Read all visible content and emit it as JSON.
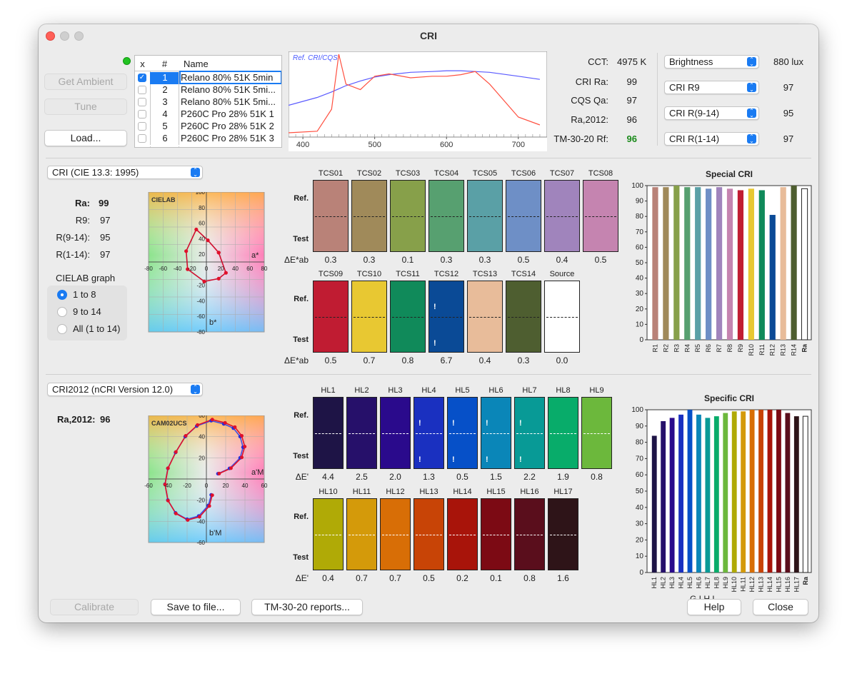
{
  "window": {
    "title": "CRI"
  },
  "left_buttons": {
    "get_ambient": "Get Ambient",
    "tune": "Tune",
    "load": "Load..."
  },
  "list": {
    "headers": {
      "x": "x",
      "num": "#",
      "name": "Name"
    },
    "rows": [
      {
        "num": "1",
        "name": "Relano 80% 51K 5min",
        "checked": true,
        "selected": true
      },
      {
        "num": "2",
        "name": "Relano 80% 51K 5mi...",
        "checked": false
      },
      {
        "num": "3",
        "name": "Relano 80% 51K 5mi...",
        "checked": false
      },
      {
        "num": "4",
        "name": "P260C Pro 28% 51K 1",
        "checked": false
      },
      {
        "num": "5",
        "name": "P260C Pro 28% 51K 2",
        "checked": false
      },
      {
        "num": "6",
        "name": "P260C Pro 28% 51K 3",
        "checked": false
      }
    ]
  },
  "spectrum": {
    "legend": "Ref. CRI/CQS",
    "x_ticks": [
      "400",
      "500",
      "600",
      "700"
    ],
    "ref_color": "#5a5aff",
    "test_color": "#ff5040"
  },
  "metrics": {
    "cct_label": "CCT:",
    "cct_value": "4975 K",
    "cri_ra_label": "CRI Ra:",
    "cri_ra_value": "99",
    "cqs_label": "CQS Qa:",
    "cqs_value": "97",
    "ra2012_label": "Ra,2012:",
    "ra2012_value": "96",
    "tm30_label": "TM-30-20 Rf:",
    "tm30_value": "96",
    "tm30_color": "#1a8a1a"
  },
  "selectors": [
    {
      "label": "Brightness",
      "value": "880 lux"
    },
    {
      "label": "CRI R9",
      "value": "97"
    },
    {
      "label": "CRI R(9-14)",
      "value": "95"
    },
    {
      "label": "CRI R(1-14)",
      "value": "97"
    }
  ],
  "cri_section": {
    "method": "CRI (CIE 13.3: 1995)",
    "ra_label": "Ra:",
    "ra_value": "99",
    "r9_label": "R9:",
    "r9_value": "97",
    "r914_label": "R(9-14):",
    "r914_value": "95",
    "r114_label": "R(1-14):",
    "r114_value": "97",
    "graph_title": "CIELAB graph",
    "radio_options": [
      "1 to 8",
      "9 to 14",
      "All (1 to 14)"
    ],
    "radio_selected": 0,
    "plot_label": "CIELAB",
    "axis_a": "a*",
    "axis_b": "b*",
    "x_ticks": [
      "-80",
      "-60",
      "-40",
      "-20",
      "0",
      "20",
      "40",
      "60",
      "80"
    ],
    "y_ticks": [
      "100",
      "80",
      "60",
      "40",
      "20",
      "0",
      "-20",
      "-40",
      "-60",
      "-80"
    ],
    "tcs_row1": [
      {
        "name": "TCS01",
        "color": "#b98278",
        "de": "0.3"
      },
      {
        "name": "TCS02",
        "color": "#a08a5a",
        "de": "0.3"
      },
      {
        "name": "TCS03",
        "color": "#87a04a",
        "de": "0.1"
      },
      {
        "name": "TCS04",
        "color": "#57a070",
        "de": "0.3"
      },
      {
        "name": "TCS05",
        "color": "#5aa0a6",
        "de": "0.3"
      },
      {
        "name": "TCS06",
        "color": "#6e8fc6",
        "de": "0.5"
      },
      {
        "name": "TCS07",
        "color": "#a084bc",
        "de": "0.4"
      },
      {
        "name": "TCS08",
        "color": "#c584b0",
        "de": "0.5"
      }
    ],
    "tcs_row2": [
      {
        "name": "TCS09",
        "color": "#c01c32",
        "de": "0.5"
      },
      {
        "name": "TCS10",
        "color": "#e8c832",
        "de": "0.7"
      },
      {
        "name": "TCS11",
        "color": "#108a5a",
        "de": "0.8"
      },
      {
        "name": "TCS12",
        "color": "#0a4a96",
        "de": "6.7",
        "warn": true
      },
      {
        "name": "TCS13",
        "color": "#e8bc9a",
        "de": "0.4"
      },
      {
        "name": "TCS14",
        "color": "#4e5e30",
        "de": "0.3"
      },
      {
        "name": "Source",
        "color": "#ffffff",
        "de": "0.0"
      }
    ],
    "ref_label": "Ref.",
    "test_label": "Test",
    "de_label": "ΔE*ab"
  },
  "special_cri": {
    "title": "Special CRI",
    "y_ticks": [
      "100",
      "90",
      "80",
      "70",
      "60",
      "50",
      "40",
      "30",
      "20",
      "10",
      "0"
    ],
    "ylim": [
      0,
      100
    ]
  },
  "cri2012_section": {
    "method": "CRI2012 (nCRI Version 12.0)",
    "ra_label": "Ra,2012:",
    "ra_value": "96",
    "plot_label": "CAM02UCS",
    "axis_a": "a'M",
    "axis_b": "b'M",
    "x_ticks": [
      "-60",
      "-40",
      "-20",
      "0",
      "20",
      "40",
      "60"
    ],
    "y_ticks": [
      "60",
      "40",
      "20",
      "0",
      "-20",
      "-40",
      "-60"
    ],
    "hl_row1": [
      {
        "name": "HL1",
        "color": "#1e1446",
        "de": "4.4"
      },
      {
        "name": "HL2",
        "color": "#26106a",
        "de": "2.5"
      },
      {
        "name": "HL3",
        "color": "#2a0a8c",
        "de": "2.0"
      },
      {
        "name": "HL4",
        "color": "#1a30c0",
        "de": "1.3",
        "warn": true
      },
      {
        "name": "HL5",
        "color": "#0650c8",
        "de": "0.5",
        "warn": true
      },
      {
        "name": "HL6",
        "color": "#0a86b8",
        "de": "1.5",
        "warn": true
      },
      {
        "name": "HL7",
        "color": "#089a96",
        "de": "2.2",
        "warn": true
      },
      {
        "name": "HL8",
        "color": "#08ac6a",
        "de": "1.9"
      },
      {
        "name": "HL9",
        "color": "#6cb83c",
        "de": "0.8"
      }
    ],
    "hl_row2": [
      {
        "name": "HL10",
        "color": "#b0aa06",
        "de": "0.4"
      },
      {
        "name": "HL11",
        "color": "#d49a0a",
        "de": "0.7"
      },
      {
        "name": "HL12",
        "color": "#d86e06",
        "de": "0.7"
      },
      {
        "name": "HL13",
        "color": "#c84406",
        "de": "0.5"
      },
      {
        "name": "HL14",
        "color": "#a8140a",
        "de": "0.2"
      },
      {
        "name": "HL15",
        "color": "#7c0a14",
        "de": "0.1"
      },
      {
        "name": "HL16",
        "color": "#5a0e1c",
        "de": "0.8"
      },
      {
        "name": "HL17",
        "color": "#2e1418",
        "de": "1.6"
      }
    ],
    "ref_label": "Ref.",
    "test_label": "Test",
    "de_label": "ΔE'"
  },
  "specific_cri": {
    "title": "Specific CRI",
    "y_ticks": [
      "100",
      "90",
      "80",
      "70",
      "60",
      "50",
      "40",
      "30",
      "20",
      "10",
      "0"
    ],
    "x_footer": "G I H L"
  },
  "chart_data": [
    {
      "type": "bar",
      "title": "Special CRI",
      "categories": [
        "R1",
        "R2",
        "R3",
        "R4",
        "R5",
        "R6",
        "R7",
        "R8",
        "R9",
        "R10",
        "R11",
        "R12",
        "R13",
        "R14",
        "Ra"
      ],
      "values": [
        99,
        99,
        100,
        99,
        99,
        98,
        99,
        98,
        97,
        98,
        97,
        81,
        99,
        100,
        98
      ],
      "colors": [
        "#b98278",
        "#a08a5a",
        "#87a04a",
        "#57a070",
        "#5aa0a6",
        "#6e8fc6",
        "#a084bc",
        "#c584b0",
        "#c01c32",
        "#e8c832",
        "#108a5a",
        "#0a4a96",
        "#e8bc9a",
        "#4e5e30",
        "#ffffff"
      ],
      "ylim": [
        0,
        100
      ]
    },
    {
      "type": "bar",
      "title": "Specific CRI",
      "categories": [
        "HL1",
        "HL2",
        "HL3",
        "HL4",
        "HL5",
        "HL6",
        "HL7",
        "HL8",
        "HL9",
        "HL10",
        "HL11",
        "HL12",
        "HL13",
        "HL14",
        "HL15",
        "HL16",
        "HL17",
        "Ra"
      ],
      "values": [
        84,
        93,
        95,
        97,
        100,
        97,
        95,
        96,
        98,
        99,
        99,
        100,
        100,
        100,
        100,
        98,
        96,
        96
      ],
      "colors": [
        "#1e1446",
        "#26106a",
        "#2a0a8c",
        "#1a30c0",
        "#0650c8",
        "#0a86b8",
        "#089a96",
        "#08ac6a",
        "#6cb83c",
        "#b0aa06",
        "#d49a0a",
        "#d86e06",
        "#c84406",
        "#a8140a",
        "#7c0a14",
        "#5a0e1c",
        "#2e1418",
        "#ffffff"
      ],
      "ylim": [
        0,
        100
      ]
    },
    {
      "type": "line",
      "title": "Ref. CRI/CQS",
      "x": [
        380,
        420,
        440,
        450,
        460,
        480,
        500,
        520,
        550,
        580,
        600,
        620,
        640,
        660,
        700,
        730
      ],
      "series": [
        {
          "name": "Ref. CRI/CQS",
          "values": [
            0.35,
            0.45,
            0.52,
            0.56,
            0.6,
            0.66,
            0.71,
            0.74,
            0.77,
            0.78,
            0.79,
            0.79,
            0.78,
            0.77,
            0.72,
            0.68
          ]
        },
        {
          "values": [
            0.0,
            0.02,
            0.3,
            1.0,
            0.62,
            0.55,
            0.72,
            0.75,
            0.7,
            0.72,
            0.72,
            0.74,
            0.78,
            0.62,
            0.2,
            0.1
          ]
        }
      ]
    },
    {
      "type": "scatter",
      "title": "CIELAB",
      "points": [
        [
          17,
          13
        ],
        [
          2,
          30
        ],
        [
          -14,
          45
        ],
        [
          -28,
          15
        ],
        [
          -26,
          -10
        ],
        [
          -3,
          -27
        ],
        [
          17,
          -23
        ],
        [
          27,
          -15
        ],
        [
          17,
          13
        ]
      ]
    },
    {
      "type": "scatter",
      "title": "CAM02UCS",
      "points": [
        [
          12,
          5
        ],
        [
          24,
          10
        ],
        [
          35,
          20
        ],
        [
          38,
          30
        ],
        [
          35,
          40
        ],
        [
          28,
          48
        ],
        [
          18,
          52
        ],
        [
          5,
          55
        ],
        [
          -10,
          50
        ],
        [
          -22,
          40
        ],
        [
          -32,
          25
        ],
        [
          -40,
          10
        ],
        [
          -43,
          -5
        ],
        [
          -40,
          -20
        ],
        [
          -32,
          -32
        ],
        [
          -20,
          -38
        ],
        [
          -8,
          -35
        ],
        [
          2,
          -25
        ],
        [
          5,
          -15
        ]
      ]
    }
  ]
}
